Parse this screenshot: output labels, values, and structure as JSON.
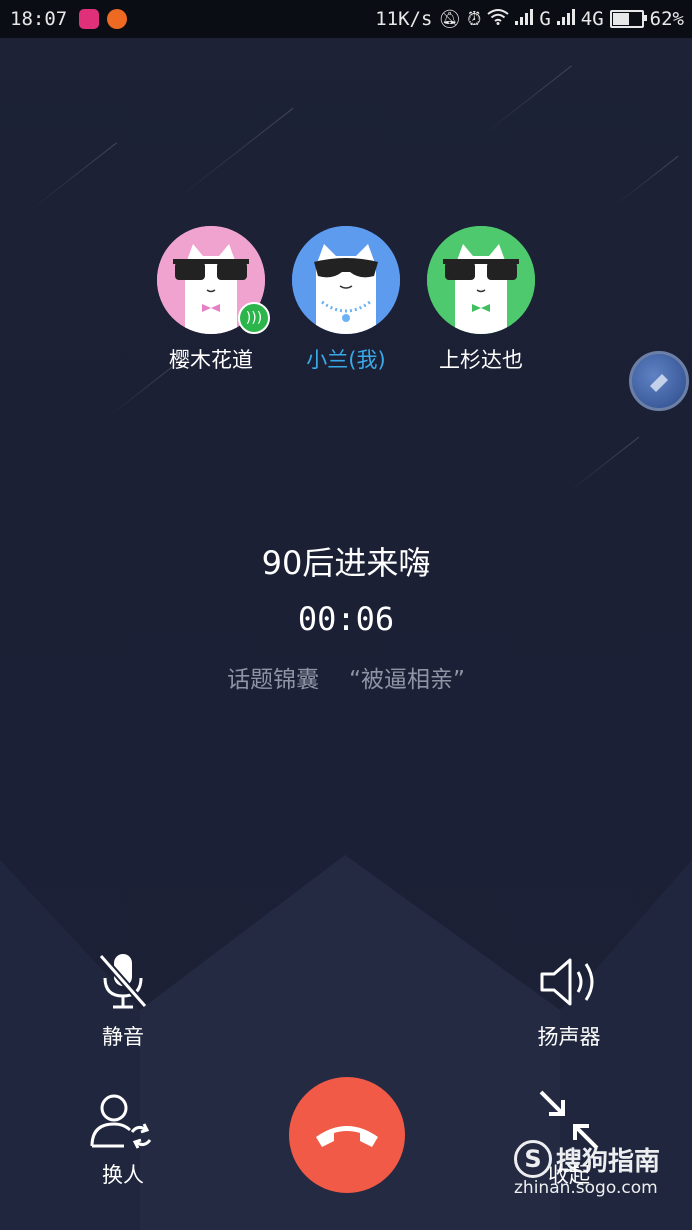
{
  "status_bar": {
    "time": "18:07",
    "net_speed": "11K/s",
    "signal1": "G",
    "signal2": "4G",
    "battery_percent": "62%",
    "battery_level": 0.62
  },
  "participants": [
    {
      "name": "樱木花道",
      "is_me": false,
      "speaking": true,
      "bg_color": "#f1a3cf"
    },
    {
      "name": "小兰(我)",
      "is_me": true,
      "speaking": false,
      "bg_color": "#5d9bef"
    },
    {
      "name": "上杉达也",
      "is_me": false,
      "speaking": false,
      "bg_color": "#4fc96e"
    }
  ],
  "call": {
    "group_name": "90后进来嗨",
    "duration": "00:06",
    "topic_label": "话题锦囊",
    "topic_value": "“被逼相亲”"
  },
  "controls": {
    "mute_label": "静音",
    "speaker_label": "扬声器",
    "switch_label": "换人",
    "collapse_label": "收起"
  },
  "watermark": {
    "logo_letter": "S",
    "brand": "搜狗指南",
    "url": "zhinan.sogo.com"
  },
  "colors": {
    "background": "#1c2137",
    "accent_me": "#3aa9e8",
    "hangup": "#f05a47",
    "speaking_badge": "#2cb54a"
  }
}
